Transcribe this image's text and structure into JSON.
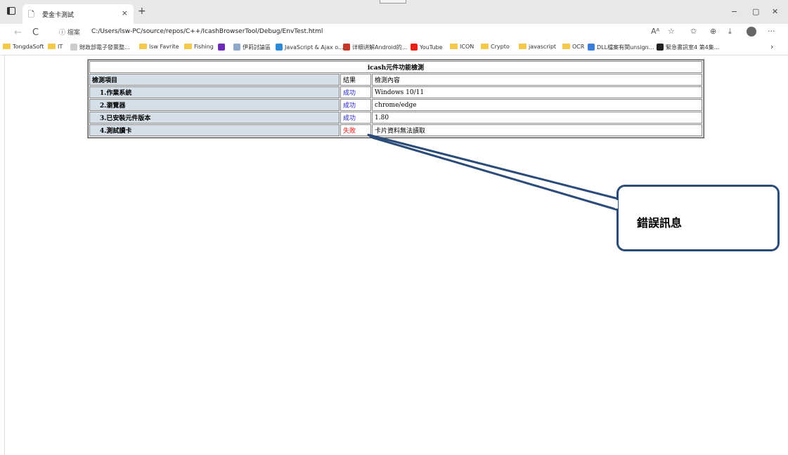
{
  "browser": {
    "tab": {
      "title": "愛金卡測試",
      "close": "×"
    },
    "new_tab": "+",
    "window_controls": [
      "−",
      "▢",
      "✕"
    ],
    "nav": {
      "back": "←",
      "reload": "C"
    },
    "address": {
      "info_label": "ⓘ 檔案",
      "url": "C:/Users/lsw-PC/source/repos/C++/IcashBrowserTool/Debug/EnvTest.html"
    },
    "right_icons": [
      "Aᴬ",
      "☆",
      "✩",
      "⊕",
      "⤓",
      "···"
    ],
    "bookmarks": [
      {
        "label": "TongdaSoft",
        "icon": "folder"
      },
      {
        "label": "IT",
        "icon": "folder"
      },
      {
        "label": "財政部電子發票整...",
        "icon": "site"
      },
      {
        "label": "lsw Favrite",
        "icon": "folder"
      },
      {
        "label": "Fishing",
        "icon": "folder"
      },
      {
        "label": "",
        "icon": "site-purple"
      },
      {
        "label": "伊莉討論區",
        "icon": "site"
      },
      {
        "label": "JavaScript & Ajax o...",
        "icon": "site-blue"
      },
      {
        "label": "详细讲解Android的...",
        "icon": "site-red"
      },
      {
        "label": "YouTube",
        "icon": "youtube"
      },
      {
        "label": "ICON",
        "icon": "folder"
      },
      {
        "label": "Crypto",
        "icon": "folder"
      },
      {
        "label": "javascript",
        "icon": "folder"
      },
      {
        "label": "OCR",
        "icon": "folder"
      },
      {
        "label": "DLL檔案有関unsign...",
        "icon": "site-blue"
      },
      {
        "label": "緊急書訊室4 第4集...",
        "icon": "site-dark"
      }
    ],
    "bookmarks_more": "›"
  },
  "page": {
    "table": {
      "title": "icash元件功能檢測",
      "header": {
        "item": "檢測項目",
        "result": "結果",
        "detail": "檢測內容"
      },
      "rows": [
        {
          "item": "1.作業系統",
          "result": "成功",
          "detail": "Windows 10/11",
          "status": "ok"
        },
        {
          "item": "2.瀏覽器",
          "result": "成功",
          "detail": "chrome/edge",
          "status": "ok"
        },
        {
          "item": "3.已安裝元件版本",
          "result": "成功",
          "detail": "1.80",
          "status": "ok"
        },
        {
          "item": "4.測試讀卡",
          "result": "失敗",
          "detail": "卡片資料無法讀取",
          "status": "fail"
        }
      ]
    },
    "callout": {
      "text": "錯誤訊息"
    }
  },
  "colors": {
    "ok": "#2222cc",
    "fail": "#ee2222",
    "label_bg": "#d6dfe8",
    "callout_border": "#2b4b78"
  }
}
